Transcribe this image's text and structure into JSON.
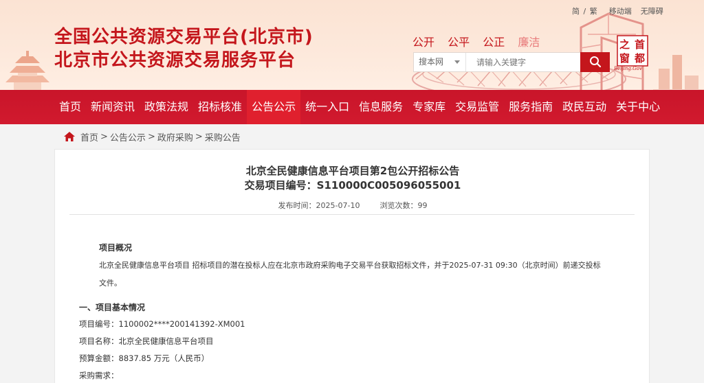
{
  "header": {
    "toplinks": {
      "simplified": "简",
      "sep": "/",
      "traditional": "繁",
      "mobile": "移动端",
      "accessible": "无障碍"
    },
    "title_line1": "全国公共资源交易平台(北京市)",
    "title_line2": "北京市公共资源交易服务平台",
    "values": [
      "公开",
      "公平",
      "公正",
      "廉洁"
    ],
    "search": {
      "scope": "搜本网",
      "placeholder": "请输入关键字",
      "button_icon": "search-icon"
    },
    "logo_chars": [
      "首",
      "都",
      "之",
      "窗"
    ],
    "logo_caption": "Beijing.Gov"
  },
  "nav": {
    "items": [
      "首页",
      "新闻资讯",
      "政策法规",
      "招标核准",
      "公告公示",
      "统一入口",
      "信息服务",
      "专家库",
      "交易监管",
      "服务指南",
      "政民互动",
      "关于中心"
    ],
    "active_index": 4
  },
  "breadcrumb": {
    "home_icon": "home-icon",
    "items": [
      "首页",
      "公告公示",
      "政府采购",
      "采购公告"
    ],
    "separator": ">"
  },
  "article": {
    "title": "北京全民健康信息平台项目第2包公开招标公告",
    "code_label": "交易项目编号：",
    "code": "S110000C005096055001",
    "publish_label": "发布时间：",
    "publish_date": "2025-07-10",
    "views_label": "浏览次数：",
    "views": "99",
    "overview_heading": "项目概况",
    "overview_text": "北京全民健康信息平台项目 招标项目的潜在投标人应在北京市政府采购电子交易平台获取招标文件，并于2025-07-31 09:30（北京时间）前递交投标文件。",
    "section1_heading": "一、项目基本情况",
    "fields": [
      {
        "label": "项目编号：",
        "value": "1100002****200141392-XM001"
      },
      {
        "label": "项目名称：",
        "value": "北京全民健康信息平台项目"
      },
      {
        "label": "预算金额：",
        "value": "8837.85 万元（人民币）"
      },
      {
        "label": "采购需求：",
        "value": ""
      }
    ]
  },
  "colors": {
    "brand_red": "#c4161c",
    "nav_red": "#d11a2e",
    "active_red": "#e0202e"
  }
}
